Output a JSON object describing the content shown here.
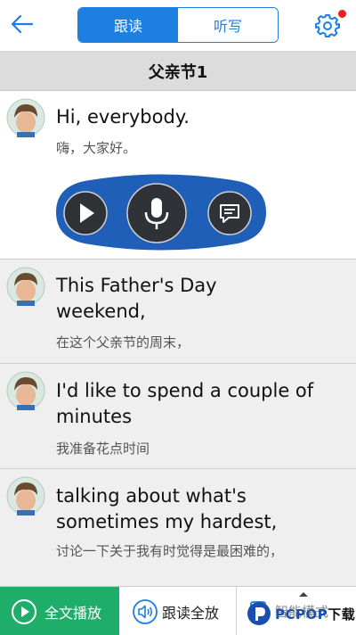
{
  "header": {
    "tabs": [
      {
        "label": "跟读",
        "active": true
      },
      {
        "label": "听写",
        "active": false
      }
    ],
    "accent_color": "#1d7fe0",
    "notification_dot_color": "#ee1c25"
  },
  "lesson": {
    "title": "父亲节1"
  },
  "sentences": [
    {
      "en": "Hi, everybody.",
      "zh": "嗨，大家好。"
    },
    {
      "en": "This Father's Day weekend,",
      "zh": "在这个父亲节的周末，"
    },
    {
      "en": "I'd like to spend a couple of minutes",
      "zh": "我准备花点时间"
    },
    {
      "en": "talking about what's sometimes my hardest,",
      "zh": "讨论一下关于我有时觉得是最困难的，"
    }
  ],
  "player": {
    "icons": [
      "play-icon",
      "microphone-icon",
      "comment-icon"
    ]
  },
  "bottombar": {
    "play_all_label": "全文播放",
    "follow_all_label": "跟读全放",
    "smart_mode_label": "智能模式",
    "play_all_color": "#1fae6a"
  },
  "watermark": {
    "brand": "PCPOP",
    "suffix": "下载"
  }
}
